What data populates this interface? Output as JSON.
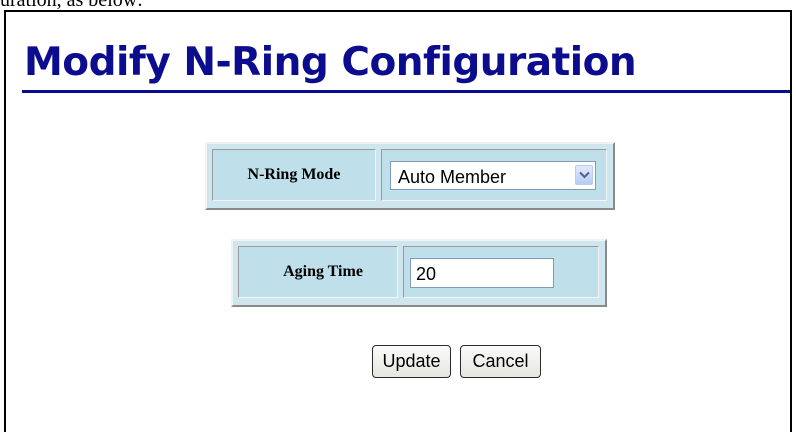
{
  "top_caption": "uration, as below:",
  "page": {
    "title": "Modify N-Ring Configuration"
  },
  "nring_mode": {
    "label": "N-Ring Mode",
    "selected": "Auto Member"
  },
  "aging_time": {
    "label": "Aging Time",
    "value": "20"
  },
  "buttons": {
    "update": "Update",
    "cancel": "Cancel"
  },
  "colors": {
    "title": "#0c0c8e",
    "cell_background": "#bfe0ea"
  },
  "icons": {
    "dropdown": "chevron-down-icon"
  }
}
